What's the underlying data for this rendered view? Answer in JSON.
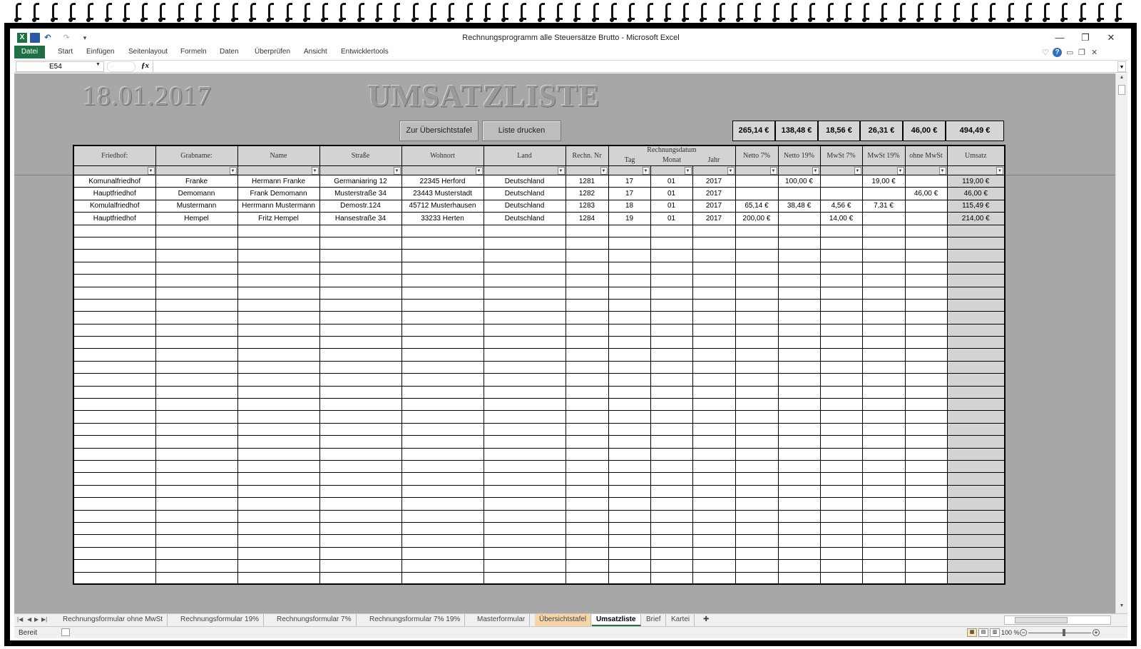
{
  "window": {
    "title": "Rechnungsprogramm alle Steuersätze Brutto  -  Microsoft Excel",
    "minimize": "—",
    "restore": "❐",
    "close": "✕"
  },
  "ribbon": {
    "tabs": [
      "Datei",
      "Start",
      "Einfügen",
      "Seitenlayout",
      "Formeln",
      "Daten",
      "Überprüfen",
      "Ansicht",
      "Entwicklertools"
    ],
    "accent": "#1e7145"
  },
  "formula_bar": {
    "cell_ref": "E54",
    "fx": "fx",
    "value": ""
  },
  "sheet": {
    "date": "18.01.2017",
    "title": "UMSATZLISTE",
    "button_overview": "Zur Übersichtstafel",
    "button_print": "Liste drucken",
    "totals": [
      "265,14 €",
      "138,48 €",
      "18,56 €",
      "26,31 €",
      "46,00 €",
      "494,49 €"
    ],
    "headers": {
      "friedhof": "Friedhof:",
      "grabname": "Grabname:",
      "name": "Name",
      "strasse": "Straße",
      "wohnort": "Wohnort",
      "land": "Land",
      "rechn_nr": "Rechn. Nr",
      "rechnungsdatum": "Rechnungsdatum",
      "tag": "Tag",
      "monat": "Monat",
      "jahr": "Jahr",
      "netto7": "Netto 7%",
      "netto19": "Netto 19%",
      "mwst7": "MwSt 7%",
      "mwst19": "MwSt 19%",
      "ohne_mwst": "ohne MwSt",
      "umsatz": "Umsatz"
    },
    "rows": [
      [
        "Komunalfriedhof",
        "Franke",
        "Hermann Franke",
        "Germaniaring 12",
        "22345 Herford",
        "Deutschland",
        "1281",
        "17",
        "01",
        "2017",
        "",
        "100,00 €",
        "",
        "19,00 €",
        "",
        "119,00 €"
      ],
      [
        "Hauptfriedhof",
        "Demomann",
        "Frank Demomann",
        "Musterstraße 34",
        "23443 Musterstadt",
        "Deutschland",
        "1282",
        "17",
        "01",
        "2017",
        "",
        "",
        "",
        "",
        "46,00 €",
        "46,00 €"
      ],
      [
        "Komulalfriedhof",
        "Mustermann",
        "Herrmann Mustermann",
        "Demostr.124",
        "45712 Musterhausen",
        "Deutschland",
        "1283",
        "18",
        "01",
        "2017",
        "65,14 €",
        "38,48 €",
        "4,56 €",
        "7,31 €",
        "",
        "115,49 €"
      ],
      [
        "Hauptfriedhof",
        "Hempel",
        "Fritz Hempel",
        "Hansestraße 34",
        "33233 Herten",
        "Deutschland",
        "1284",
        "19",
        "01",
        "2017",
        "200,00 €",
        "",
        "14,00 €",
        "",
        "",
        "214,00 €"
      ]
    ],
    "empty_rows": 29
  },
  "sheet_tabs": {
    "tabs": [
      "Rechnungsformular ohne MwSt",
      "Rechnungsformular 19%",
      "Rechnungsformular 7%",
      "Rechnungsformular 7% 19%",
      "Masterformular",
      "Übersichtstafel",
      "Umsatzliste",
      "Brief",
      "Kartei"
    ],
    "active": "Umsatzliste",
    "highlighted": "Übersichtstafel",
    "highlight_color": "#f7d5a8"
  },
  "status": {
    "text": "Bereit",
    "zoom": "100 %"
  }
}
